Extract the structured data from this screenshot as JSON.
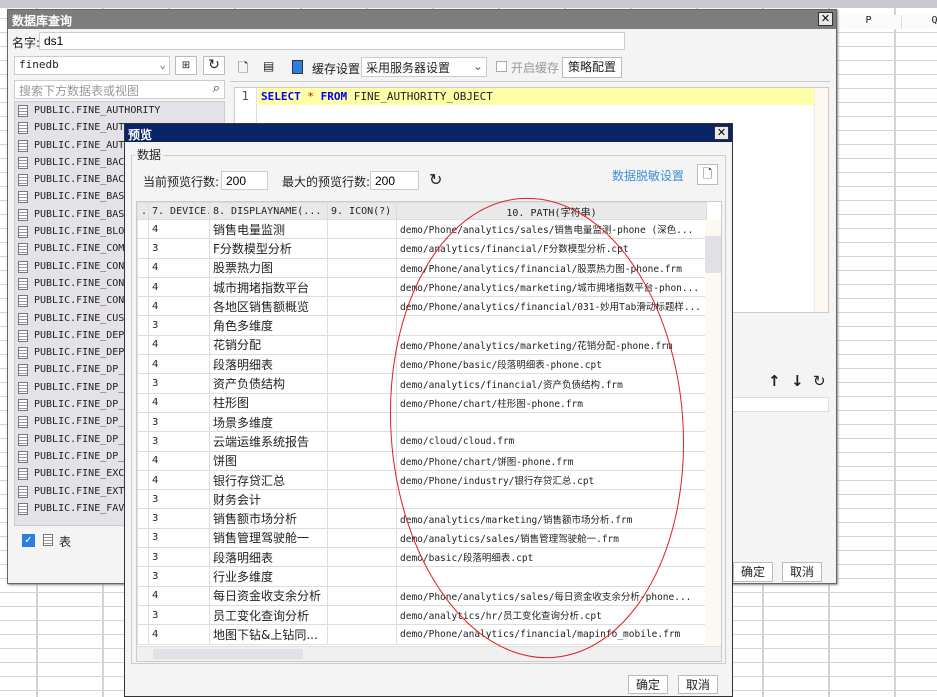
{
  "sheet": {
    "columns": [
      "P",
      "Q"
    ]
  },
  "db_dialog": {
    "title": "数据库查询",
    "name_label": "名字:",
    "name_value": "ds1",
    "connection": "finedb",
    "search_placeholder": "搜索下方数据表或视图",
    "tables": [
      "PUBLIC.FINE_AUTHORITY",
      "PUBLIC.FINE_AUTH",
      "PUBLIC.FINE_AUTH",
      "PUBLIC.FINE_BACK",
      "PUBLIC.FINE_BACK",
      "PUBLIC.FINE_BASE",
      "PUBLIC.FINE_BASE",
      "PUBLIC.FINE_BLOC",
      "PUBLIC.FINE_COMP",
      "PUBLIC.FINE_CONF",
      "PUBLIC.FINE_CONF",
      "PUBLIC.FINE_CONF",
      "PUBLIC.FINE_CUST",
      "PUBLIC.FINE_DEPA",
      "PUBLIC.FINE_DEP_",
      "PUBLIC.FINE_DP_C",
      "PUBLIC.FINE_DP_C",
      "PUBLIC.FINE_DP_D",
      "PUBLIC.FINE_DP_D",
      "PUBLIC.FINE_DP_E",
      "PUBLIC.FINE_DP_U",
      "PUBLIC.FINE_EXCE",
      "PUBLIC.FINE_EXTR",
      "PUBLIC.FINE_FAVO"
    ],
    "table_filter_label": "表",
    "cache_label": "缓存设置",
    "cache_option": "采用服务器设置",
    "enable_cache_label": "开启缓存",
    "strategy_button": "策略配置",
    "sql_line": "1",
    "sql_kw1": "SELECT",
    "sql_star": "*",
    "sql_kw2": "FROM",
    "sql_table": "FINE_AUTHORITY_OBJECT",
    "ok": "确定",
    "cancel": "取消"
  },
  "preview": {
    "title": "预览",
    "group_label": "数据",
    "current_rows_label": "当前预览行数:",
    "current_rows": "200",
    "max_rows_label": "最大的预览行数:",
    "max_rows": "200",
    "masking_link": "数据脱敏设置",
    "headers": [
      "..",
      "7. DEVICE...",
      "8. DISPLAYNAME(...",
      "9. ICON(?)",
      "10. PATH(字符串)"
    ],
    "rows": [
      [
        "4",
        "销售电量监测",
        "demo/Phone/analytics/sales/销售电量监测-phone (深色..."
      ],
      [
        "3",
        "F分数模型分析",
        "demo/analytics/financial/F分数模型分析.cpt"
      ],
      [
        "4",
        "股票热力图",
        "demo/Phone/analytics/financial/股票热力图-phone.frm"
      ],
      [
        "4",
        "城市拥堵指数平台",
        "demo/Phone/analytics/marketing/城市拥堵指数平台-phon..."
      ],
      [
        "4",
        "各地区销售额概览",
        "demo/Phone/analytics/financial/031-妙用Tab滑动标题样..."
      ],
      [
        "3",
        "角色多维度",
        ""
      ],
      [
        "4",
        "花销分配",
        "demo/Phone/analytics/marketing/花销分配-phone.frm"
      ],
      [
        "4",
        "段落明细表",
        "demo/Phone/basic/段落明细表-phone.cpt"
      ],
      [
        "3",
        "资产负债结构",
        "demo/analytics/financial/资产负债结构.frm"
      ],
      [
        "4",
        "柱形图",
        "demo/Phone/chart/柱形图-phone.frm"
      ],
      [
        "3",
        "场景多维度",
        ""
      ],
      [
        "3",
        "云端运维系统报告",
        "demo/cloud/cloud.frm"
      ],
      [
        "4",
        "饼图",
        "demo/Phone/chart/饼图-phone.frm"
      ],
      [
        "4",
        "银行存贷汇总",
        "demo/Phone/industry/银行存贷汇总.cpt"
      ],
      [
        "3",
        "财务会计",
        ""
      ],
      [
        "3",
        "销售额市场分析",
        "demo/analytics/marketing/销售额市场分析.frm"
      ],
      [
        "3",
        "销售管理驾驶舱一",
        "demo/analytics/sales/销售管理驾驶舱一.frm"
      ],
      [
        "3",
        "段落明细表",
        "demo/basic/段落明细表.cpt"
      ],
      [
        "3",
        "行业多维度",
        ""
      ],
      [
        "4",
        "每日资金收支余分析",
        "demo/Phone/analytics/sales/每日资金收支余分析-phone..."
      ],
      [
        "3",
        "员工变化查询分析",
        "demo/analytics/hr/员工变化查询分析.cpt"
      ],
      [
        "4",
        "地图下钻&上钻同...",
        "demo/Phone/analytics/financial/mapinfo_mobile.frm"
      ]
    ],
    "ok": "确定",
    "cancel": "取消"
  },
  "colors": {
    "preview_title": "#0a246a",
    "annotation": "#e02020",
    "sql_keyword": "#0000ff",
    "link": "#3d8fd8"
  }
}
